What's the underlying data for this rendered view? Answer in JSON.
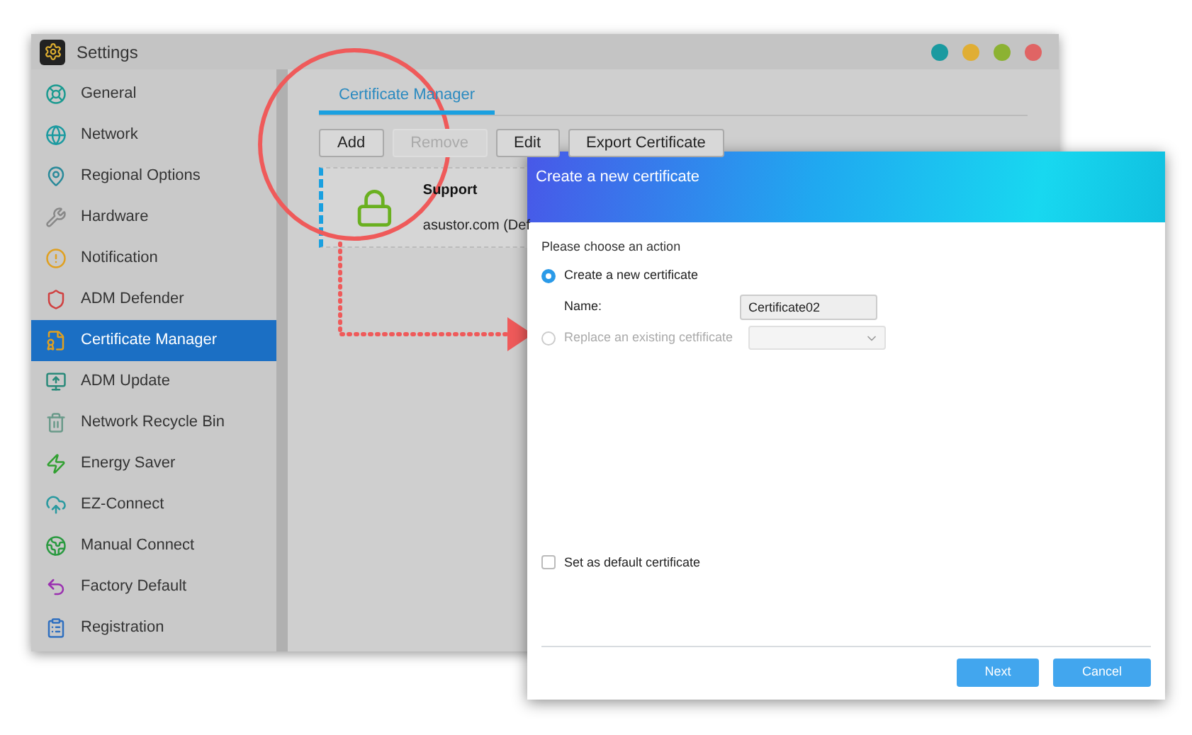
{
  "window": {
    "title": "Settings",
    "controls": [
      {
        "color": "#1a9aa0"
      },
      {
        "color": "#e0ae34"
      },
      {
        "color": "#8cb232"
      },
      {
        "color": "#e06464"
      }
    ]
  },
  "sidebar": {
    "items": [
      {
        "label": "General",
        "selected": false
      },
      {
        "label": "Network",
        "selected": false
      },
      {
        "label": "Regional Options",
        "selected": false
      },
      {
        "label": "Hardware",
        "selected": false
      },
      {
        "label": "Notification",
        "selected": false
      },
      {
        "label": "ADM Defender",
        "selected": false
      },
      {
        "label": "Certificate Manager",
        "selected": true
      },
      {
        "label": "ADM Update",
        "selected": false
      },
      {
        "label": "Network Recycle Bin",
        "selected": false
      },
      {
        "label": "Energy Saver",
        "selected": false
      },
      {
        "label": "EZ-Connect",
        "selected": false
      },
      {
        "label": "Manual Connect",
        "selected": false
      },
      {
        "label": "Factory Default",
        "selected": false
      },
      {
        "label": "Registration",
        "selected": false
      }
    ]
  },
  "tabs": [
    {
      "label": "Certificate Manager",
      "selected": true
    }
  ],
  "toolbar": [
    {
      "label": "Add",
      "disabled": false
    },
    {
      "label": "Remove",
      "disabled": true
    },
    {
      "label": "Edit",
      "disabled": false
    },
    {
      "label": "Export Certificate",
      "disabled": false
    }
  ],
  "certificates": [
    {
      "name": "Support",
      "domain": "asustor.com (Def",
      "selected": true
    }
  ],
  "dialog": {
    "title": "Create a new certificate",
    "prompt": "Please choose an action",
    "options": [
      {
        "label": "Create a new certificate",
        "selected": true,
        "disabled": false
      },
      {
        "label": "Replace an existing cetfificate",
        "selected": false,
        "disabled": true
      }
    ],
    "name_label": "Name:",
    "name_value": "Certificate02",
    "default_checkbox": {
      "label": "Set as default certificate",
      "checked": false
    },
    "buttons": [
      "Next",
      "Cancel"
    ]
  }
}
